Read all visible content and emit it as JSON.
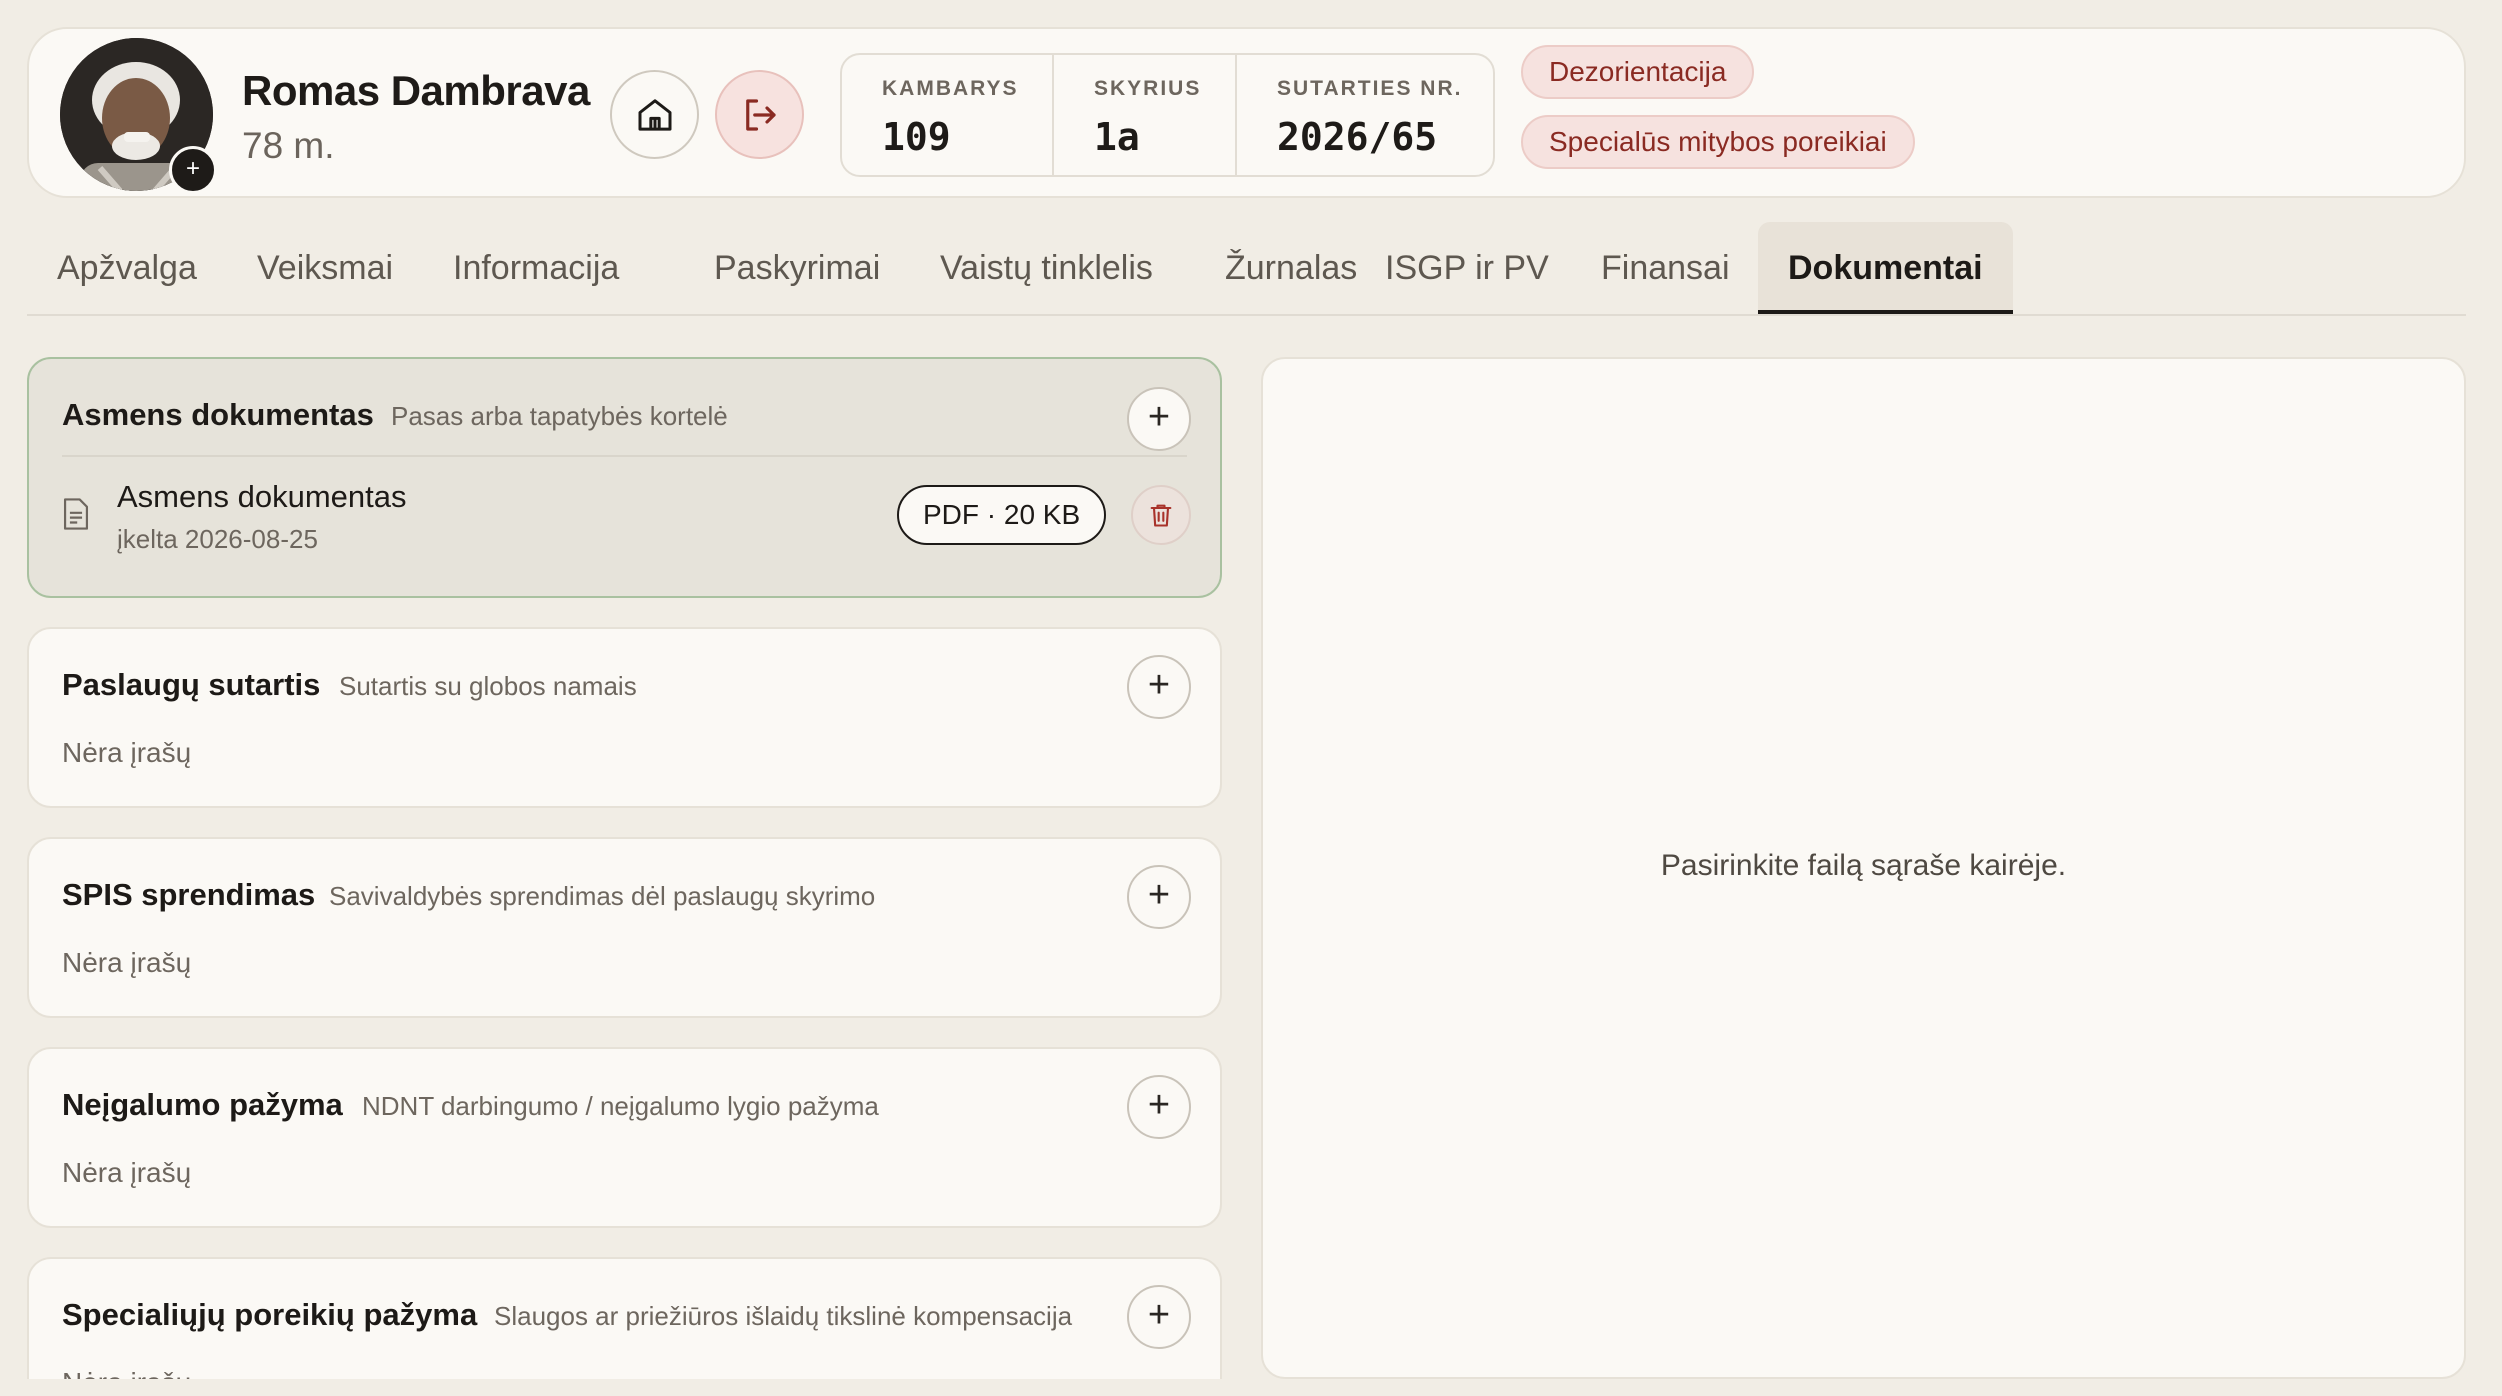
{
  "patient": {
    "name": "Romas Dambrava",
    "age": "78 m.",
    "avatar_add": "+"
  },
  "meta": [
    {
      "label": "KAMBARYS",
      "value": "109"
    },
    {
      "label": "SKYRIUS",
      "value": "1a"
    },
    {
      "label": "SUTARTIES NR.",
      "value": "2026/65"
    }
  ],
  "tags": [
    "Dezorientacija",
    "Specialūs mitybos poreikiai"
  ],
  "tabs": [
    "Apžvalga",
    "Veiksmai",
    "Informacija",
    "Paskyrimai",
    "Vaistų tinklelis",
    "Žurnalas",
    "ISGP ir PV",
    "Finansai",
    "Dokumentai"
  ],
  "active_tab": "Dokumentai",
  "sections": [
    {
      "title": "Asmens dokumentas",
      "subtitle": "Pasas arba tapatybės kortelė",
      "file": {
        "name": "Asmens dokumentas",
        "date": "įkelta 2026-08-25",
        "badge": "PDF · 20 KB"
      }
    },
    {
      "title": "Paslaugų sutartis",
      "subtitle": "Sutartis su globos namais",
      "empty": "Nėra įrašų"
    },
    {
      "title": "SPIS sprendimas",
      "subtitle": "Savivaldybės sprendimas dėl paslaugų skyrimo",
      "empty": "Nėra įrašų"
    },
    {
      "title": "Neįgalumo pažyma",
      "subtitle": "NDNT darbingumo / neįgalumo lygio pažyma",
      "empty": "Nėra įrašų"
    },
    {
      "title": "Specialiųjų poreikių pažyma",
      "subtitle": "Slaugos ar priežiūros išlaidų tikslinė kompensacija",
      "empty": "Nėra įrašų"
    }
  ],
  "add_label": "+",
  "preview": {
    "placeholder": "Pasirinkite failą sąraše kairėje."
  },
  "colors": {
    "accent_tag_bg": "#f6e2df",
    "accent_tag_text": "#8a2a22",
    "active_card_border": "#a9c1a0"
  }
}
